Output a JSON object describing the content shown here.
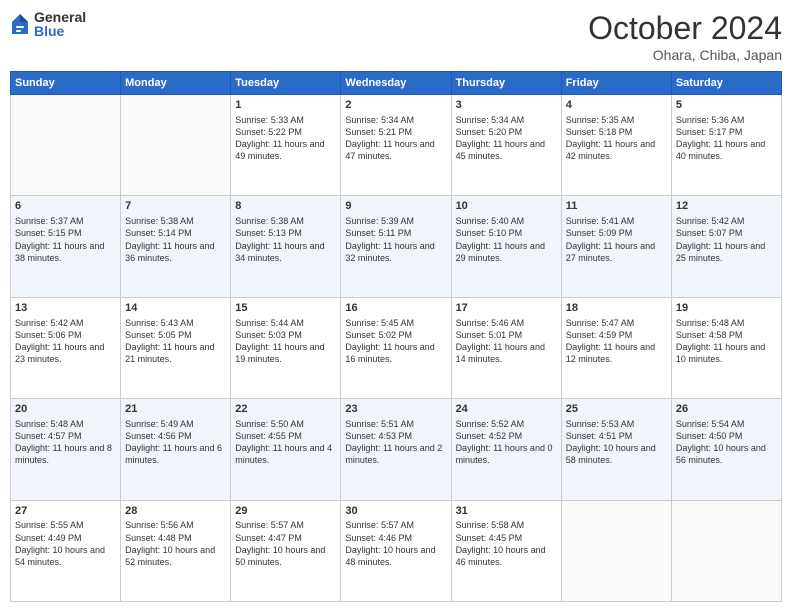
{
  "logo": {
    "general": "General",
    "blue": "Blue"
  },
  "title": "October 2024",
  "location": "Ohara, Chiba, Japan",
  "days_of_week": [
    "Sunday",
    "Monday",
    "Tuesday",
    "Wednesday",
    "Thursday",
    "Friday",
    "Saturday"
  ],
  "weeks": [
    [
      {
        "day": "",
        "sunrise": "",
        "sunset": "",
        "daylight": ""
      },
      {
        "day": "",
        "sunrise": "",
        "sunset": "",
        "daylight": ""
      },
      {
        "day": "1",
        "sunrise": "Sunrise: 5:33 AM",
        "sunset": "Sunset: 5:22 PM",
        "daylight": "Daylight: 11 hours and 49 minutes."
      },
      {
        "day": "2",
        "sunrise": "Sunrise: 5:34 AM",
        "sunset": "Sunset: 5:21 PM",
        "daylight": "Daylight: 11 hours and 47 minutes."
      },
      {
        "day": "3",
        "sunrise": "Sunrise: 5:34 AM",
        "sunset": "Sunset: 5:20 PM",
        "daylight": "Daylight: 11 hours and 45 minutes."
      },
      {
        "day": "4",
        "sunrise": "Sunrise: 5:35 AM",
        "sunset": "Sunset: 5:18 PM",
        "daylight": "Daylight: 11 hours and 42 minutes."
      },
      {
        "day": "5",
        "sunrise": "Sunrise: 5:36 AM",
        "sunset": "Sunset: 5:17 PM",
        "daylight": "Daylight: 11 hours and 40 minutes."
      }
    ],
    [
      {
        "day": "6",
        "sunrise": "Sunrise: 5:37 AM",
        "sunset": "Sunset: 5:15 PM",
        "daylight": "Daylight: 11 hours and 38 minutes."
      },
      {
        "day": "7",
        "sunrise": "Sunrise: 5:38 AM",
        "sunset": "Sunset: 5:14 PM",
        "daylight": "Daylight: 11 hours and 36 minutes."
      },
      {
        "day": "8",
        "sunrise": "Sunrise: 5:38 AM",
        "sunset": "Sunset: 5:13 PM",
        "daylight": "Daylight: 11 hours and 34 minutes."
      },
      {
        "day": "9",
        "sunrise": "Sunrise: 5:39 AM",
        "sunset": "Sunset: 5:11 PM",
        "daylight": "Daylight: 11 hours and 32 minutes."
      },
      {
        "day": "10",
        "sunrise": "Sunrise: 5:40 AM",
        "sunset": "Sunset: 5:10 PM",
        "daylight": "Daylight: 11 hours and 29 minutes."
      },
      {
        "day": "11",
        "sunrise": "Sunrise: 5:41 AM",
        "sunset": "Sunset: 5:09 PM",
        "daylight": "Daylight: 11 hours and 27 minutes."
      },
      {
        "day": "12",
        "sunrise": "Sunrise: 5:42 AM",
        "sunset": "Sunset: 5:07 PM",
        "daylight": "Daylight: 11 hours and 25 minutes."
      }
    ],
    [
      {
        "day": "13",
        "sunrise": "Sunrise: 5:42 AM",
        "sunset": "Sunset: 5:06 PM",
        "daylight": "Daylight: 11 hours and 23 minutes."
      },
      {
        "day": "14",
        "sunrise": "Sunrise: 5:43 AM",
        "sunset": "Sunset: 5:05 PM",
        "daylight": "Daylight: 11 hours and 21 minutes."
      },
      {
        "day": "15",
        "sunrise": "Sunrise: 5:44 AM",
        "sunset": "Sunset: 5:03 PM",
        "daylight": "Daylight: 11 hours and 19 minutes."
      },
      {
        "day": "16",
        "sunrise": "Sunrise: 5:45 AM",
        "sunset": "Sunset: 5:02 PM",
        "daylight": "Daylight: 11 hours and 16 minutes."
      },
      {
        "day": "17",
        "sunrise": "Sunrise: 5:46 AM",
        "sunset": "Sunset: 5:01 PM",
        "daylight": "Daylight: 11 hours and 14 minutes."
      },
      {
        "day": "18",
        "sunrise": "Sunrise: 5:47 AM",
        "sunset": "Sunset: 4:59 PM",
        "daylight": "Daylight: 11 hours and 12 minutes."
      },
      {
        "day": "19",
        "sunrise": "Sunrise: 5:48 AM",
        "sunset": "Sunset: 4:58 PM",
        "daylight": "Daylight: 11 hours and 10 minutes."
      }
    ],
    [
      {
        "day": "20",
        "sunrise": "Sunrise: 5:48 AM",
        "sunset": "Sunset: 4:57 PM",
        "daylight": "Daylight: 11 hours and 8 minutes."
      },
      {
        "day": "21",
        "sunrise": "Sunrise: 5:49 AM",
        "sunset": "Sunset: 4:56 PM",
        "daylight": "Daylight: 11 hours and 6 minutes."
      },
      {
        "day": "22",
        "sunrise": "Sunrise: 5:50 AM",
        "sunset": "Sunset: 4:55 PM",
        "daylight": "Daylight: 11 hours and 4 minutes."
      },
      {
        "day": "23",
        "sunrise": "Sunrise: 5:51 AM",
        "sunset": "Sunset: 4:53 PM",
        "daylight": "Daylight: 11 hours and 2 minutes."
      },
      {
        "day": "24",
        "sunrise": "Sunrise: 5:52 AM",
        "sunset": "Sunset: 4:52 PM",
        "daylight": "Daylight: 11 hours and 0 minutes."
      },
      {
        "day": "25",
        "sunrise": "Sunrise: 5:53 AM",
        "sunset": "Sunset: 4:51 PM",
        "daylight": "Daylight: 10 hours and 58 minutes."
      },
      {
        "day": "26",
        "sunrise": "Sunrise: 5:54 AM",
        "sunset": "Sunset: 4:50 PM",
        "daylight": "Daylight: 10 hours and 56 minutes."
      }
    ],
    [
      {
        "day": "27",
        "sunrise": "Sunrise: 5:55 AM",
        "sunset": "Sunset: 4:49 PM",
        "daylight": "Daylight: 10 hours and 54 minutes."
      },
      {
        "day": "28",
        "sunrise": "Sunrise: 5:56 AM",
        "sunset": "Sunset: 4:48 PM",
        "daylight": "Daylight: 10 hours and 52 minutes."
      },
      {
        "day": "29",
        "sunrise": "Sunrise: 5:57 AM",
        "sunset": "Sunset: 4:47 PM",
        "daylight": "Daylight: 10 hours and 50 minutes."
      },
      {
        "day": "30",
        "sunrise": "Sunrise: 5:57 AM",
        "sunset": "Sunset: 4:46 PM",
        "daylight": "Daylight: 10 hours and 48 minutes."
      },
      {
        "day": "31",
        "sunrise": "Sunrise: 5:58 AM",
        "sunset": "Sunset: 4:45 PM",
        "daylight": "Daylight: 10 hours and 46 minutes."
      },
      {
        "day": "",
        "sunrise": "",
        "sunset": "",
        "daylight": ""
      },
      {
        "day": "",
        "sunrise": "",
        "sunset": "",
        "daylight": ""
      }
    ]
  ]
}
